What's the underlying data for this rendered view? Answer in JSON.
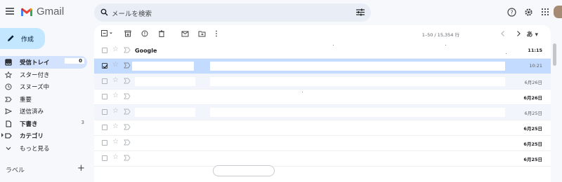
{
  "app": {
    "name": "Gmail"
  },
  "search": {
    "placeholder": "メールを検索"
  },
  "compose": {
    "label": "作成"
  },
  "nav": {
    "items": [
      {
        "label": "受信トレイ",
        "count": "0",
        "icon": "inbox-icon",
        "active": true,
        "bold": true
      },
      {
        "label": "スター付き",
        "count": "",
        "icon": "star-icon"
      },
      {
        "label": "スヌーズ中",
        "count": "",
        "icon": "clock-icon"
      },
      {
        "label": "重要",
        "count": "",
        "icon": "important-icon"
      },
      {
        "label": "送信済み",
        "count": "",
        "icon": "send-icon"
      },
      {
        "label": "下書き",
        "count": "3",
        "icon": "draft-icon",
        "bold": true
      },
      {
        "label": "カテゴリ",
        "count": "",
        "icon": "label-icon",
        "bold": true
      },
      {
        "label": "もっと見る",
        "count": "",
        "icon": "chevron-down-icon"
      }
    ],
    "labels_heading": "ラベル",
    "labels_add": "+"
  },
  "toolbar": {
    "pager": "1–50 / 15,354 行",
    "lang": "あ"
  },
  "emails": [
    {
      "sender": "Google",
      "date": "11:15",
      "state": "unread"
    },
    {
      "sender": "",
      "date": "10:21",
      "state": "selected"
    },
    {
      "sender": "",
      "date": "6月26日",
      "state": "read"
    },
    {
      "sender": "",
      "date": "6月26日",
      "state": "unread"
    },
    {
      "sender": "",
      "date": "6月25日",
      "state": "read"
    },
    {
      "sender": "",
      "date": "6月25日",
      "state": "unread"
    },
    {
      "sender": "",
      "date": "6月25日",
      "state": "unread"
    },
    {
      "sender": "",
      "date": "6月25日",
      "state": "unread"
    }
  ],
  "colors": {
    "accent": "#c2e7ff",
    "selected_row": "#c2dbff",
    "active_nav": "#d3e3fd",
    "background": "#f6f8fc"
  }
}
